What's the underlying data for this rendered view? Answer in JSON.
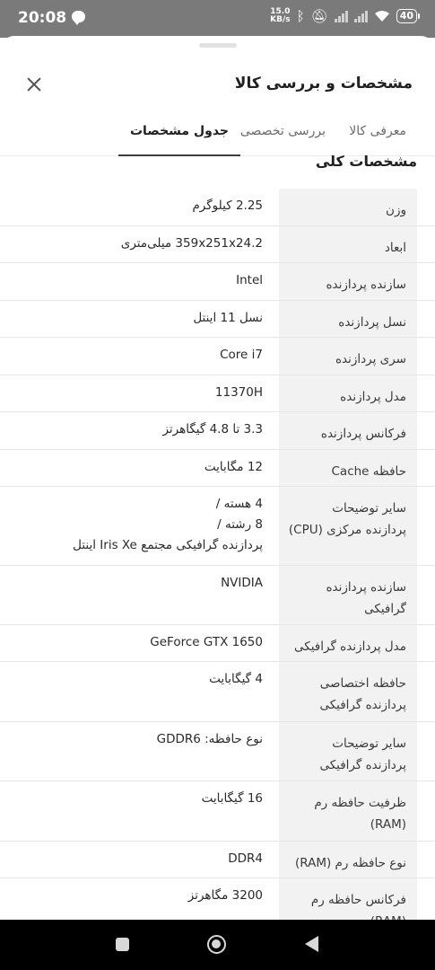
{
  "status_bar": {
    "time": "20:08",
    "net_speed_value": "15.0",
    "net_speed_unit": "KB/s",
    "battery": "40"
  },
  "sheet": {
    "title": "مشخصات و بررسی کالا",
    "tabs": [
      "معرفی کالا",
      "بررسی تخصصی",
      "جدول مشخصات"
    ],
    "active_tab": "جدول مشخصات",
    "section_title": "مشخصات کلی"
  },
  "specs": [
    {
      "label": "وزن",
      "value": "2.25 کیلوگرم"
    },
    {
      "label": "ابعاد",
      "value": "359x251x24.2 میلی‌متری"
    },
    {
      "label": "سازنده پردازنده",
      "value": "Intel"
    },
    {
      "label": "نسل پردازنده",
      "value": "نسل 11 اینتل"
    },
    {
      "label": "سری پردازنده",
      "value": "Core i7"
    },
    {
      "label": "مدل پردازنده",
      "value": "11370H"
    },
    {
      "label": "فرکانس پردازنده",
      "value": "3.3 تا 4.8 گیگاهرتز"
    },
    {
      "label": "حافظه Cache",
      "value": "12 مگابایت"
    },
    {
      "label": "سایر توضیحات پردازنده مرکزی (CPU)",
      "value": "4 هسته /\n8 رشته /\nپردازنده گرافیکی مجتمع Iris Xe اینتل"
    },
    {
      "label": "سازنده پردازنده گرافیکی",
      "value": "NVIDIA"
    },
    {
      "label": "مدل پردازنده گرافیکی",
      "value": "GeForce GTX 1650"
    },
    {
      "label": "حافظه اختصاصی پردازنده گرافیکی",
      "value": "4 گیگابایت"
    },
    {
      "label": "سایر توضیحات پردازنده گرافیکی",
      "value": "نوع حافظه: GDDR6"
    },
    {
      "label": "ظرفیت حافظه رم (RAM)",
      "value": "16 گیگابایت"
    },
    {
      "label": "نوع حافظه رم (RAM)",
      "value": "DDR4"
    },
    {
      "label": "فرکانس حافظه رم (RAM)",
      "value": "3200 مگاهرتز"
    }
  ]
}
